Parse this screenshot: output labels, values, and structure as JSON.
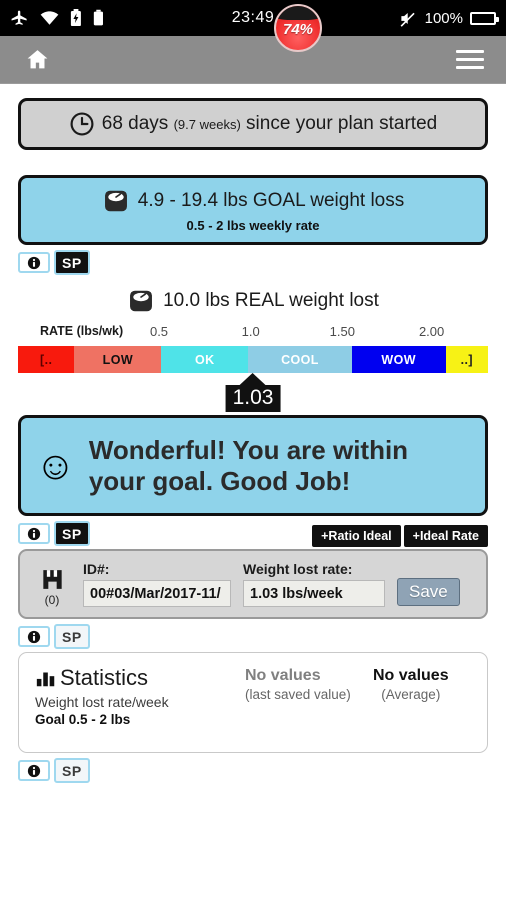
{
  "statusbar": {
    "icons_left": [
      "airplane-mode-icon",
      "wifi-icon",
      "battery-saver-icon",
      "battery-icon"
    ],
    "clock": "23:49",
    "bubble_percent": "74%",
    "mute_icon": "volume-mute-icon",
    "battery_percent": "100%"
  },
  "toolbar": {
    "home_icon": "home-icon",
    "menu_icon": "hamburger-menu-icon"
  },
  "days_card": {
    "icon": "clock-icon",
    "days": "68 days ",
    "weeks": "(9.7 weeks)",
    "suffix": " since your plan started"
  },
  "goal_card": {
    "icon": "scale-icon",
    "main": "4.9 - 19.4 lbs GOAL weight loss",
    "sub": "0.5 - 2 lbs weekly rate"
  },
  "chips": {
    "info_label": "i",
    "sp_label": "SP"
  },
  "real": {
    "icon": "scale-icon",
    "text": "10.0 lbs REAL weight lost"
  },
  "chart_data": {
    "type": "bar",
    "title": "RATE (lbs/wk)",
    "xlabel": "RATE (lbs/wk)",
    "ylabel": "",
    "axis_label": "RATE (lbs/wk)",
    "tick_labels": [
      "0.5",
      "1.0",
      "1.50",
      "2.00"
    ],
    "tick_positions_pct": [
      30.0,
      49.5,
      69.0,
      88.0
    ],
    "xlim": [
      0,
      2.5
    ],
    "grid": false,
    "legend": "none",
    "marker_value": "1.03",
    "marker_position_pct": 50.0,
    "categories": [
      "[..",
      "LOW",
      "OK",
      "COOL",
      "WOW",
      "..]"
    ],
    "segment_widths_pct": [
      12.0,
      18.5,
      18.5,
      22.0,
      20.0,
      9.0
    ],
    "segment_colors": [
      "#f81a0d",
      "#ef7263",
      "#4fe3e8",
      "#8ecde5",
      "#0000f0",
      "#f7f215"
    ],
    "segment_text_colors": [
      "#5c0000",
      "#111111",
      "#ffffff",
      "#ffffff",
      "#ffffff",
      "#222222"
    ]
  },
  "message": {
    "emoji": "☺",
    "emoji_name": "smiling-face-emoji",
    "line1": "Wonderful! You are within",
    "line2": "your goal. Good Job!"
  },
  "pills": {
    "ratio_ideal": "+Ratio Ideal",
    "ideal_rate": "+Ideal Rate"
  },
  "form": {
    "save_icon": "floppy-save-icon",
    "save_count": "(0)",
    "id_label": "ID#:",
    "id_value": "00#03/Mar/2017-11/",
    "rate_label": "Weight lost rate:",
    "rate_value": "1.03 lbs/week",
    "save_button": "Save"
  },
  "statistics": {
    "icon": "bar-chart-icon",
    "title": "Statistics",
    "sub1": "Weight lost rate/week",
    "sub2": "Goal 0.5 - 2 lbs",
    "col2_value": "No values",
    "col2_caption": "(last saved value)",
    "col3_value": "No values",
    "col3_caption": "(Average)"
  },
  "colors": {
    "toolbar": "#8c8c8c",
    "card_blue": "#8fd3ea",
    "card_grey": "#d0d0d0",
    "accent_border": "#9fd8ef"
  }
}
